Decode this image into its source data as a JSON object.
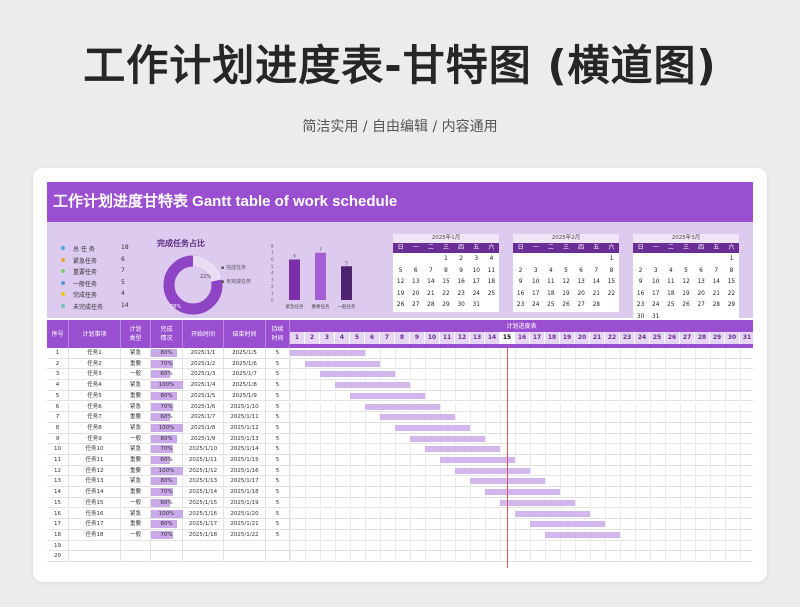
{
  "page": {
    "title": "工作计划进度表-甘特图 (横道图)",
    "subtitle": "简洁实用 / 自由编辑 / 内容通用"
  },
  "sheet": {
    "banner": "工作计划进度甘特表  Gantt table of work schedule"
  },
  "stats": [
    {
      "label": "总 任 务",
      "value": "18",
      "color": "#4aa3df"
    },
    {
      "label": "紧急任务",
      "value": "6",
      "color": "#e8a33d"
    },
    {
      "label": "重要任务",
      "value": "7",
      "color": "#7bc96f"
    },
    {
      "label": "一般任务",
      "value": "5",
      "color": "#5b9bd5"
    },
    {
      "label": "完成任务",
      "value": "4",
      "color": "#f0c419"
    },
    {
      "label": "未完成任务",
      "value": "14",
      "color": "#70c1b3"
    }
  ],
  "donut": {
    "title": "完成任务占比",
    "done_pct": "22%",
    "undone_pct": "78%",
    "legend_done": "完成任务",
    "legend_undone": "未完成任务",
    "done_fraction": 0.22,
    "done_color": "#e8ddf3",
    "undone_color": "#8e44c4"
  },
  "bar_chart": {
    "type": "bar",
    "categories": [
      "紧急任务",
      "重要任务",
      "一般任务"
    ],
    "values": [
      6,
      7,
      5
    ],
    "yticks": [
      "8",
      "7",
      "6",
      "5",
      "4",
      "3",
      "2",
      "1",
      "0"
    ],
    "ylim": [
      0,
      8
    ],
    "colors": [
      "#7b2fa8",
      "#a45fd6",
      "#4d2370"
    ]
  },
  "calendars": [
    {
      "title": "2025年1月",
      "dow": [
        "日",
        "一",
        "二",
        "三",
        "四",
        "五",
        "六"
      ],
      "days": [
        "",
        "",
        "",
        "1",
        "2",
        "3",
        "4",
        "5",
        "6",
        "7",
        "8",
        "9",
        "10",
        "11",
        "12",
        "13",
        "14",
        "15",
        "16",
        "17",
        "18",
        "19",
        "20",
        "21",
        "22",
        "23",
        "24",
        "25",
        "26",
        "27",
        "28",
        "29",
        "30",
        "31",
        ""
      ]
    },
    {
      "title": "2025年2月",
      "dow": [
        "日",
        "一",
        "二",
        "三",
        "四",
        "五",
        "六"
      ],
      "days": [
        "",
        "",
        "",
        "",
        "",
        "",
        "1",
        "2",
        "3",
        "4",
        "5",
        "6",
        "7",
        "8",
        "9",
        "10",
        "11",
        "12",
        "13",
        "14",
        "15",
        "16",
        "17",
        "18",
        "19",
        "20",
        "21",
        "22",
        "23",
        "24",
        "25",
        "26",
        "27",
        "28",
        ""
      ]
    },
    {
      "title": "2025年3月",
      "dow": [
        "日",
        "一",
        "二",
        "三",
        "四",
        "五",
        "六"
      ],
      "days": [
        "",
        "",
        "",
        "",
        "",
        "",
        "1",
        "2",
        "3",
        "4",
        "5",
        "6",
        "7",
        "8",
        "9",
        "10",
        "11",
        "12",
        "13",
        "14",
        "15",
        "16",
        "17",
        "18",
        "19",
        "20",
        "21",
        "22",
        "23",
        "24",
        "25",
        "26",
        "27",
        "28",
        "29",
        "30",
        "31"
      ]
    }
  ],
  "table": {
    "headers": {
      "no": "序号",
      "task": "计划事项",
      "type": "计划\n类型",
      "progress": "完成\n情况",
      "start": "开始时间",
      "end": "结束时间",
      "dur": "持续\n时间",
      "gantt": "计划进度表"
    },
    "days": [
      "1",
      "2",
      "3",
      "4",
      "5",
      "6",
      "7",
      "8",
      "9",
      "10",
      "11",
      "12",
      "13",
      "14",
      "15",
      "16",
      "17",
      "18",
      "19",
      "20",
      "21",
      "22",
      "23",
      "24",
      "25",
      "26",
      "27",
      "28",
      "29",
      "30",
      "31"
    ],
    "today_day": 15,
    "rows": [
      {
        "no": "1",
        "task": "任务1",
        "type": "紧急",
        "progress": "80%",
        "start": "2025/1/1",
        "end": "2025/1/5",
        "dur": "5",
        "p": 0.8,
        "s": 1,
        "e": 5
      },
      {
        "no": "2",
        "task": "任务2",
        "type": "重要",
        "progress": "70%",
        "start": "2025/1/2",
        "end": "2025/1/6",
        "dur": "5",
        "p": 0.7,
        "s": 2,
        "e": 6
      },
      {
        "no": "3",
        "task": "任务3",
        "type": "一般",
        "progress": "60%",
        "start": "2025/1/3",
        "end": "2025/1/7",
        "dur": "5",
        "p": 0.6,
        "s": 3,
        "e": 7
      },
      {
        "no": "4",
        "task": "任务4",
        "type": "紧急",
        "progress": "100%",
        "start": "2025/1/4",
        "end": "2025/1/8",
        "dur": "5",
        "p": 1.0,
        "s": 4,
        "e": 8
      },
      {
        "no": "5",
        "task": "任务5",
        "type": "重要",
        "progress": "80%",
        "start": "2025/1/5",
        "end": "2025/1/9",
        "dur": "5",
        "p": 0.8,
        "s": 5,
        "e": 9
      },
      {
        "no": "6",
        "task": "任务6",
        "type": "紧急",
        "progress": "70%",
        "start": "2025/1/6",
        "end": "2025/1/10",
        "dur": "5",
        "p": 0.7,
        "s": 6,
        "e": 10
      },
      {
        "no": "7",
        "task": "任务7",
        "type": "重要",
        "progress": "60%",
        "start": "2025/1/7",
        "end": "2025/1/11",
        "dur": "5",
        "p": 0.6,
        "s": 7,
        "e": 11
      },
      {
        "no": "8",
        "task": "任务8",
        "type": "紧急",
        "progress": "100%",
        "start": "2025/1/8",
        "end": "2025/1/12",
        "dur": "5",
        "p": 1.0,
        "s": 8,
        "e": 12
      },
      {
        "no": "9",
        "task": "任务9",
        "type": "一般",
        "progress": "80%",
        "start": "2025/1/9",
        "end": "2025/1/13",
        "dur": "5",
        "p": 0.8,
        "s": 9,
        "e": 13
      },
      {
        "no": "10",
        "task": "任务10",
        "type": "紧急",
        "progress": "70%",
        "start": "2025/1/10",
        "end": "2025/1/14",
        "dur": "5",
        "p": 0.7,
        "s": 10,
        "e": 14
      },
      {
        "no": "11",
        "task": "任务11",
        "type": "重要",
        "progress": "60%",
        "start": "2025/1/11",
        "end": "2025/1/15",
        "dur": "5",
        "p": 0.6,
        "s": 11,
        "e": 15
      },
      {
        "no": "12",
        "task": "任务12",
        "type": "重要",
        "progress": "100%",
        "start": "2025/1/12",
        "end": "2025/1/16",
        "dur": "5",
        "p": 1.0,
        "s": 12,
        "e": 16
      },
      {
        "no": "13",
        "task": "任务13",
        "type": "紧急",
        "progress": "80%",
        "start": "2025/1/13",
        "end": "2025/1/17",
        "dur": "5",
        "p": 0.8,
        "s": 13,
        "e": 17
      },
      {
        "no": "14",
        "task": "任务14",
        "type": "重要",
        "progress": "70%",
        "start": "2025/1/14",
        "end": "2025/1/18",
        "dur": "5",
        "p": 0.7,
        "s": 14,
        "e": 18
      },
      {
        "no": "15",
        "task": "任务15",
        "type": "一般",
        "progress": "60%",
        "start": "2025/1/15",
        "end": "2025/1/19",
        "dur": "5",
        "p": 0.6,
        "s": 15,
        "e": 19
      },
      {
        "no": "16",
        "task": "任务16",
        "type": "紧急",
        "progress": "100%",
        "start": "2025/1/16",
        "end": "2025/1/20",
        "dur": "5",
        "p": 1.0,
        "s": 16,
        "e": 20
      },
      {
        "no": "17",
        "task": "任务17",
        "type": "重要",
        "progress": "80%",
        "start": "2025/1/17",
        "end": "2025/1/21",
        "dur": "5",
        "p": 0.8,
        "s": 17,
        "e": 21
      },
      {
        "no": "18",
        "task": "任务18",
        "type": "一般",
        "progress": "70%",
        "start": "2025/1/18",
        "end": "2025/1/22",
        "dur": "5",
        "p": 0.7,
        "s": 18,
        "e": 22
      },
      {
        "no": "19",
        "task": "",
        "type": "",
        "progress": "",
        "start": "",
        "end": "",
        "dur": "",
        "p": 0,
        "s": 0,
        "e": 0
      },
      {
        "no": "20",
        "task": "",
        "type": "",
        "progress": "",
        "start": "",
        "end": "",
        "dur": "",
        "p": 0,
        "s": 0,
        "e": 0
      }
    ]
  },
  "colors": {
    "accent": "#9a4fd1",
    "accent_light": "#dccaef",
    "today_line": "#e05555",
    "gantt_bar": "#d2b7ef"
  }
}
